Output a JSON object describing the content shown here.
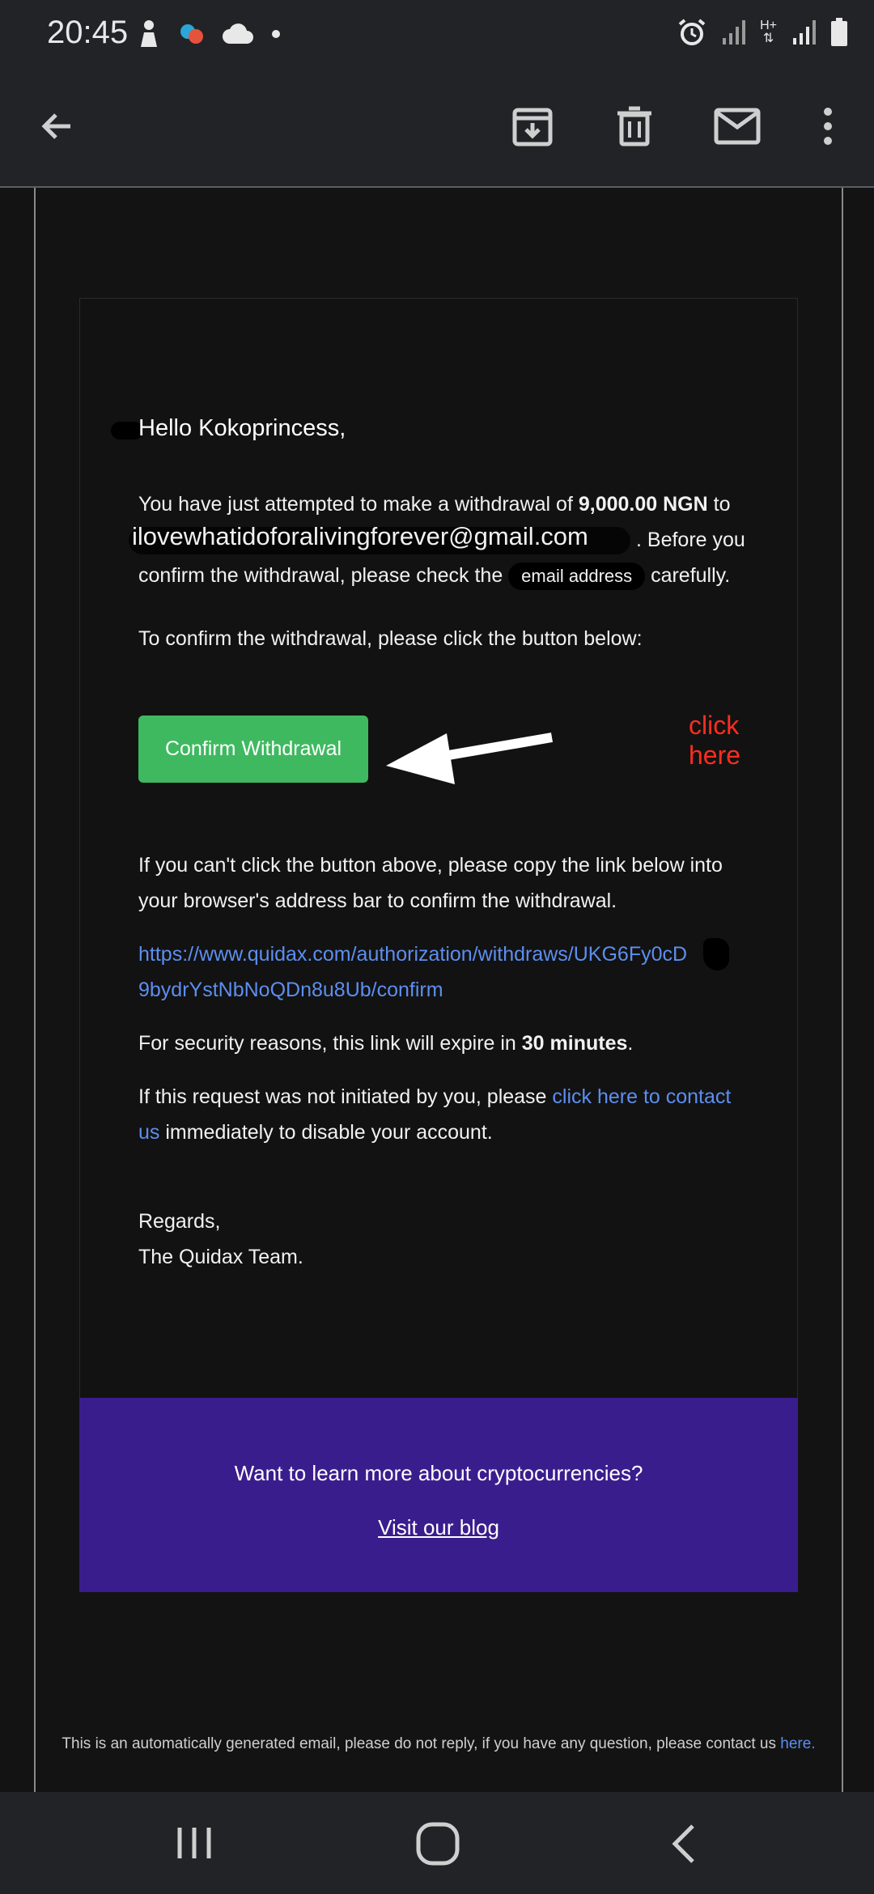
{
  "status_bar": {
    "time": "20:45",
    "left_icons": [
      "figure-icon",
      "colorful-app-icon",
      "cloud-icon",
      "dot-icon"
    ],
    "right_icons": [
      "alarm-icon",
      "signal-icon",
      "data-arrows-icon",
      "signal-icon",
      "battery-icon"
    ],
    "data_label": "H+"
  },
  "app_bar": {
    "actions": [
      "back-icon",
      "archive-icon",
      "delete-icon",
      "mail-icon",
      "more-vert-icon"
    ]
  },
  "email": {
    "greeting": "Hello Kokoprincess,",
    "para1": {
      "prefix": "You have just attempted to make a withdrawal of ",
      "amount": "9,000.00 NGN",
      "to": " to",
      "email_overlay": "ilovewhatidoforalivingforever@gmail.com",
      "suffix1": ". Before you",
      "line3_prefix": "confirm the withdrawal, please check the ",
      "email_tag": "email address",
      "line3_suffix": " carefully."
    },
    "para2": "To confirm the withdrawal, please click the button below:",
    "confirm_button": "Confirm Withdrawal",
    "annotation": "click here",
    "para3": "If you can't click the button above, please copy the link below into your browser's address bar to confirm the withdrawal.",
    "link_line1": "https://www.quidax.com/authorization/withdraws/UKG6Fy0cD",
    "link_line2": "9bydrYstNbNoQDn8u8Ub/confirm",
    "para4": {
      "prefix": "For security reasons, this link will expire in ",
      "duration": "30 minutes",
      "suffix": "."
    },
    "para5": {
      "prefix": "If this request was not initiated by you, please ",
      "link": "click here to contact us",
      "suffix": " immediately to disable your account."
    },
    "regards": "Regards,",
    "signature": "The Quidax Team.",
    "promo": {
      "question": "Want to learn more about cryptocurrencies?",
      "blog_link": "Visit our blog"
    },
    "footer": {
      "text": "This is an automatically generated email, please do not reply, if you have any question, please contact us ",
      "link": "here."
    }
  },
  "nav_bar": {
    "items": [
      "recents-icon",
      "home-icon",
      "back-nav-icon"
    ]
  },
  "colors": {
    "button_green": "#3fb960",
    "link_blue": "#5d8ef0",
    "promo_purple": "#3a1d8d",
    "annotation_red": "#ff2d1e"
  }
}
